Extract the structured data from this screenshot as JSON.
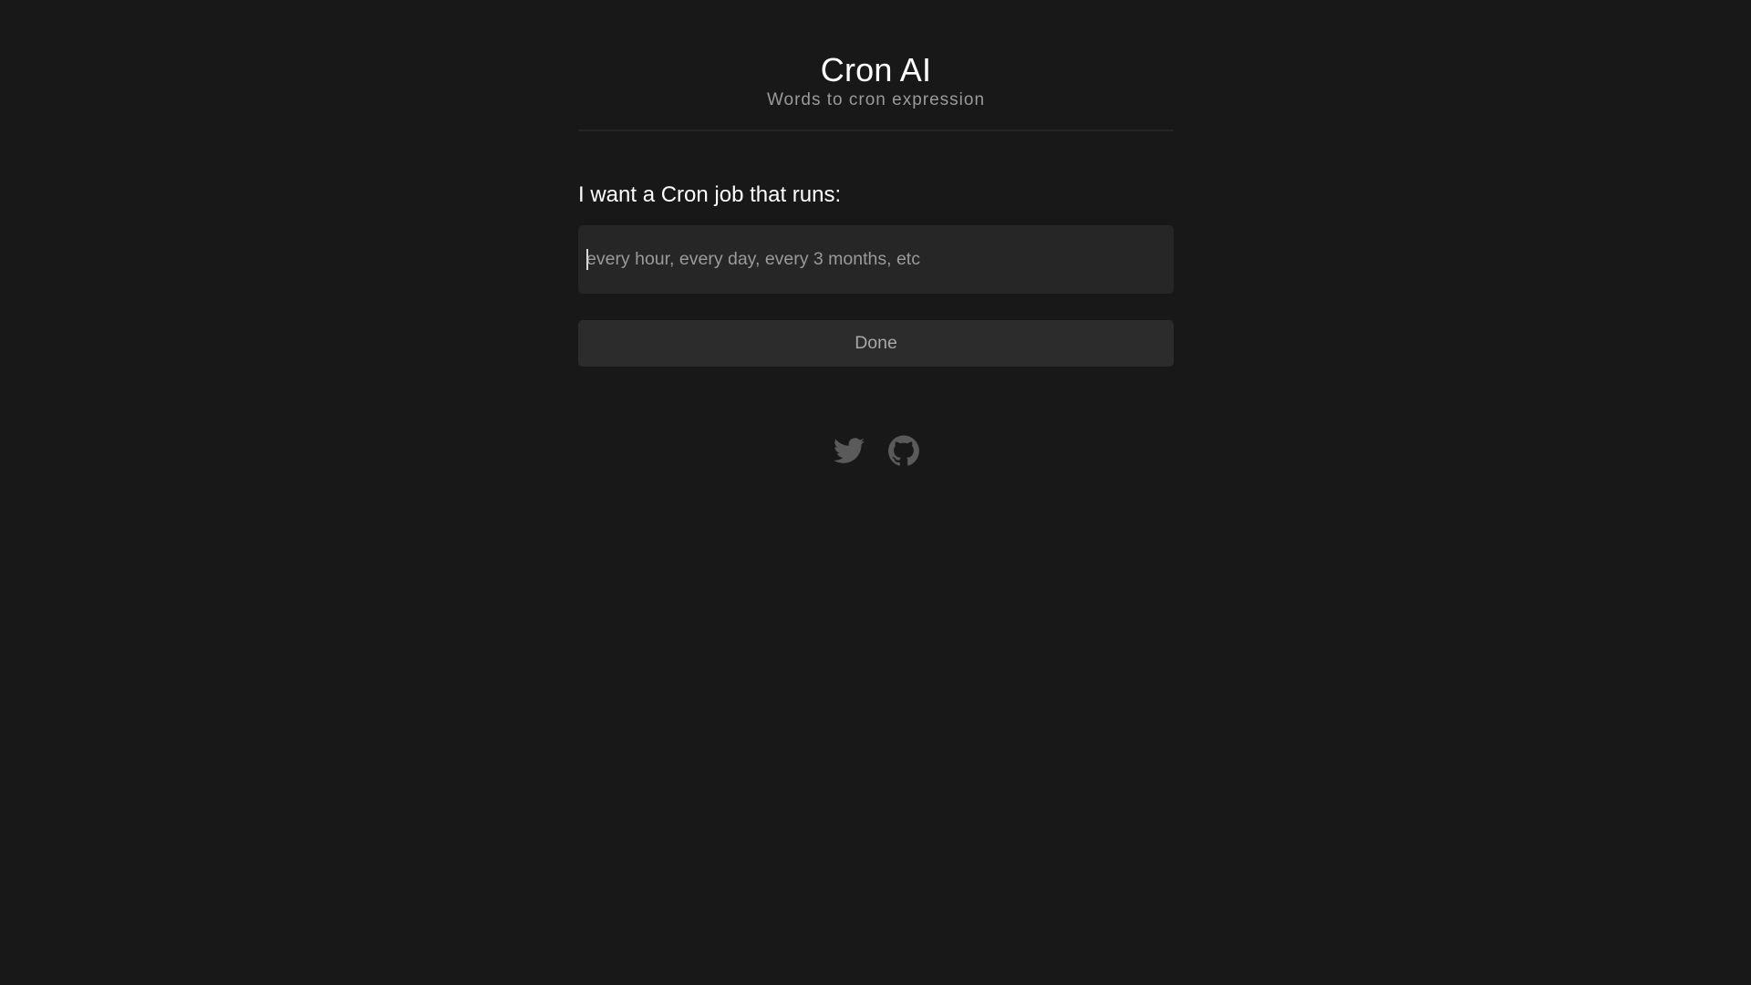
{
  "header": {
    "title": "Cron AI",
    "subtitle": "Words to cron expression"
  },
  "form": {
    "label": "I want a Cron job that runs:",
    "input_value": "",
    "input_placeholder": "every hour, every day, every 3 months, etc",
    "submit_label": "Done"
  },
  "social": {
    "links": [
      {
        "icon": "twitter-icon"
      },
      {
        "icon": "github-icon"
      }
    ]
  },
  "colors": {
    "background": "#181818",
    "input_background": "#262626",
    "button_background": "#2c2c2c",
    "icon_color": "#5a5a5a",
    "muted_text": "#9a9a9a"
  }
}
